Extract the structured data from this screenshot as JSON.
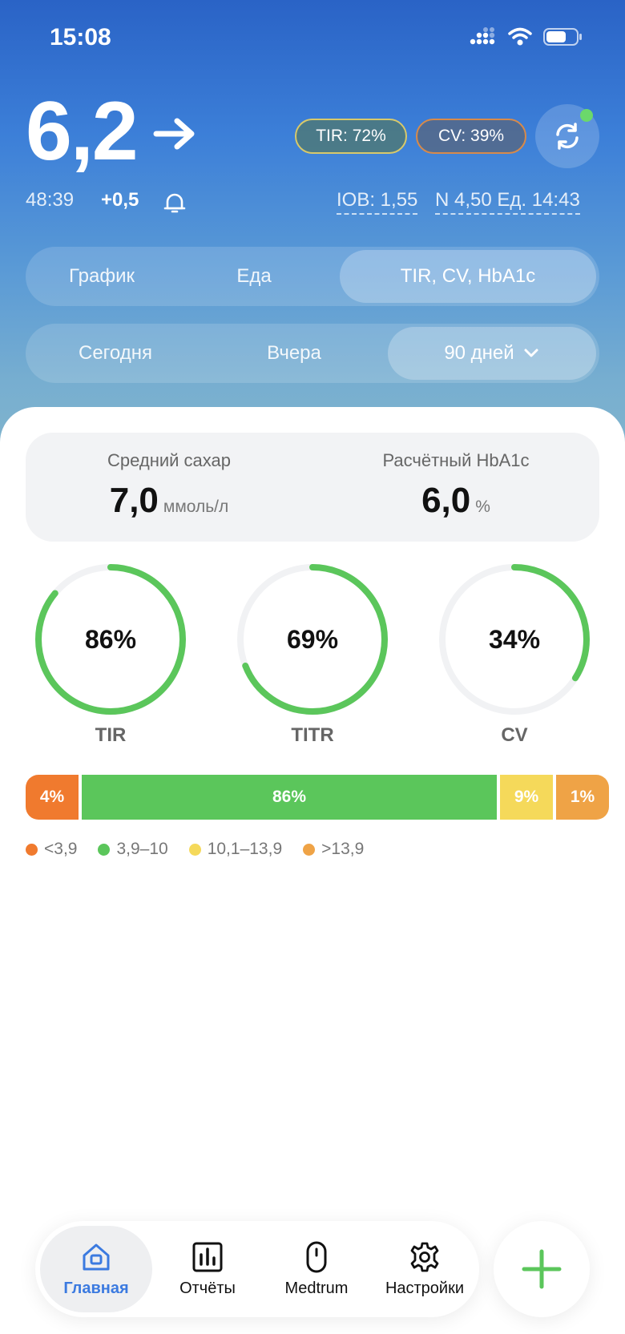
{
  "status": {
    "time": "15:08"
  },
  "glucose": {
    "value": "6,2",
    "trend_icon": "arrow-right-icon",
    "age": "48:39",
    "delta": "+0,5"
  },
  "pills": {
    "tir": "TIR: 72%",
    "cv": "CV: 39%"
  },
  "insulin": {
    "iob": "IOB: 1,55",
    "last_dose": "N 4,50 Ед. 14:43"
  },
  "view_tabs": [
    {
      "label": "График",
      "active": false
    },
    {
      "label": "Еда",
      "active": false
    },
    {
      "label": "TIR, CV, HbA1c",
      "active": true
    }
  ],
  "period_tabs": [
    {
      "label": "Сегодня",
      "active": false
    },
    {
      "label": "Вчера",
      "active": false
    },
    {
      "label": "90 дней",
      "active": true
    }
  ],
  "summary": {
    "avg_label": "Средний сахар",
    "avg_value": "7,0",
    "avg_unit": "ммоль/л",
    "hba1c_label": "Расчётный HbA1c",
    "hba1c_value": "6,0",
    "hba1c_unit": "%"
  },
  "rings": [
    {
      "label": "TIR",
      "text": "86%",
      "value": 0.86,
      "color": "#5bc65b"
    },
    {
      "label": "TITR",
      "text": "69%",
      "value": 0.69,
      "color": "#5bc65b"
    },
    {
      "label": "CV",
      "text": "34%",
      "value": 0.34,
      "color": "#5bc65b"
    }
  ],
  "range_bar": [
    {
      "text": "4%",
      "value": 4,
      "color": "#f07a2e"
    },
    {
      "text": "86%",
      "value": 86,
      "color": "#5bc65b"
    },
    {
      "text": "9%",
      "value": 9,
      "color": "#f5d95a"
    },
    {
      "text": "1%",
      "value": 1,
      "color": "#efa346"
    }
  ],
  "legend": [
    {
      "label": "<3,9",
      "color": "#f07a2e"
    },
    {
      "label": "3,9–10",
      "color": "#5bc65b"
    },
    {
      "label": "10,1–13,9",
      "color": "#f5d95a"
    },
    {
      "label": ">13,9",
      "color": "#efa346"
    }
  ],
  "tabbar": [
    {
      "label": "Главная",
      "icon": "home-icon",
      "active": true
    },
    {
      "label": "Отчёты",
      "icon": "reports-icon",
      "active": false
    },
    {
      "label": "Medtrum",
      "icon": "device-icon",
      "active": false
    },
    {
      "label": "Настройки",
      "icon": "gear-icon",
      "active": false
    }
  ],
  "fab_icon": "plus-icon"
}
